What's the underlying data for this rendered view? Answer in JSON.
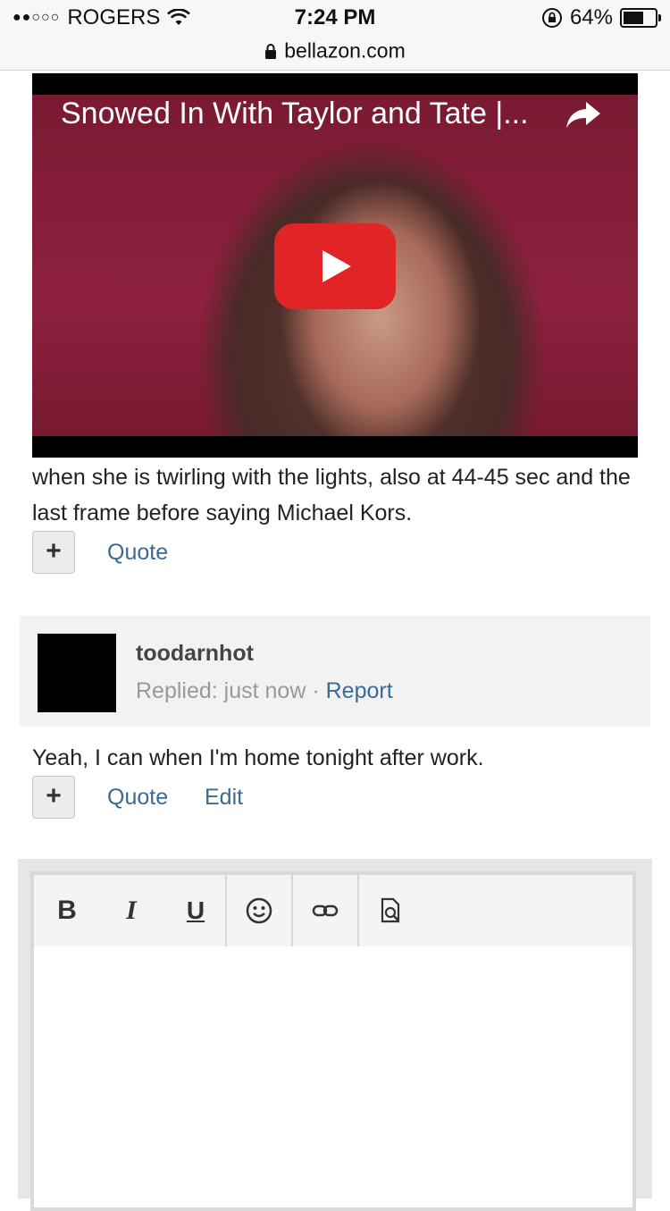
{
  "status_bar": {
    "carrier": "ROGERS",
    "time": "7:24 PM",
    "battery": "64%",
    "battery_level": 0.64
  },
  "browser": {
    "url": "bellazon.com"
  },
  "video": {
    "title": "Snowed In With Taylor and Tate |..."
  },
  "post1": {
    "text": "when she is twirling with the lights, also at 44-45 sec and the last frame before saying Michael Kors.",
    "plus_label": "+",
    "quote_label": "Quote"
  },
  "reply": {
    "author": "toodarnhot",
    "replied": "Replied: just now",
    "separator": "·",
    "report_label": "Report",
    "text": "Yeah, I can when I'm home tonight after work.",
    "plus_label": "+",
    "quote_label": "Quote",
    "edit_label": "Edit"
  },
  "editor": {
    "bold_label": "B",
    "italic_label": "I",
    "underline_label": "U",
    "value": ""
  }
}
